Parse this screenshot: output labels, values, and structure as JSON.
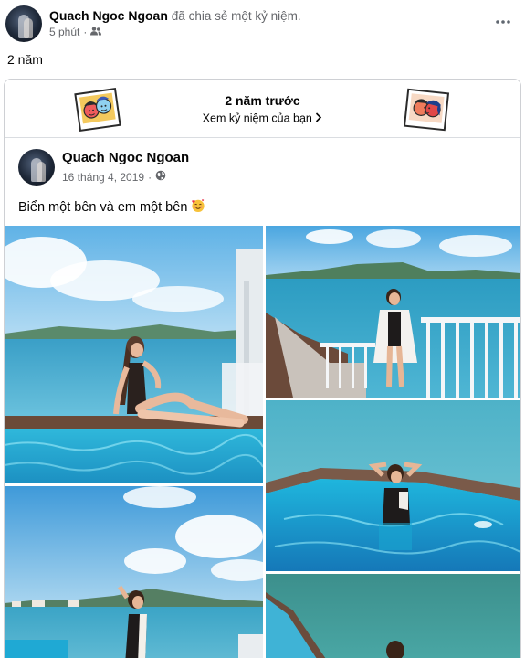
{
  "post": {
    "author": "Quach Ngoc Ngoan",
    "action": "đã chia sẻ một kỷ niệm.",
    "time": "5 phút",
    "dot": "·",
    "caption": "2 năm"
  },
  "memory": {
    "title": "2 năm trước",
    "link": "Xem kỷ niệm của bạn"
  },
  "original_post": {
    "author": "Quach Ngoc Ngoan",
    "date": "16 tháng 4, 2019",
    "dot": "·",
    "text": "Biển một bên và em một bên",
    "emoji": "🥰"
  },
  "icons": {
    "privacy_outer": "friends-icon",
    "privacy_inner": "globe-icon",
    "more": "more-options-icon",
    "chevron": "chevron-right-icon"
  },
  "colors": {
    "secondary_text": "#65676b",
    "border": "#ced0d4",
    "sky": "#7fc2ea",
    "sea": "#2fa6c9",
    "pool": "#33c3e0"
  }
}
